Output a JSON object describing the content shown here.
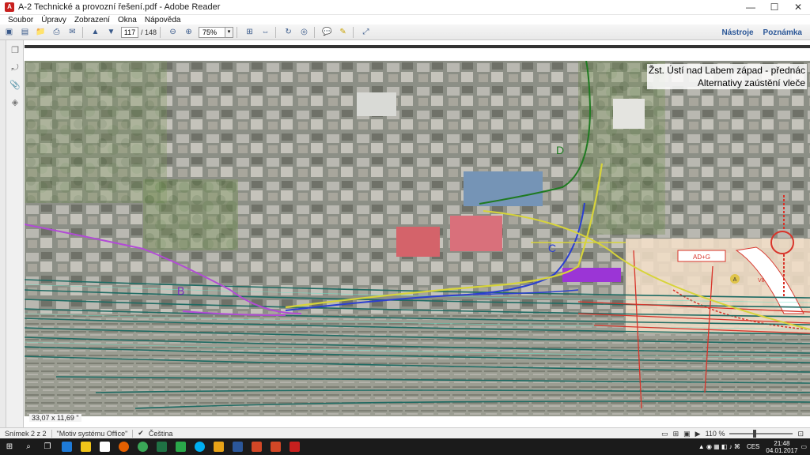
{
  "window": {
    "title": "A-2 Technické a provozní řešení.pdf - Adobe Reader",
    "minimize": "—",
    "maximize": "☐",
    "close": "✕"
  },
  "menu": [
    "Soubor",
    "Úpravy",
    "Zobrazení",
    "Okna",
    "Nápověda"
  ],
  "toolbar": {
    "page_current": "117",
    "page_total": "/ 148",
    "zoom": "75%",
    "tools_label": "Nástroje",
    "comment_label": "Poznámka"
  },
  "map": {
    "title_line1": "Žst. Ústí nad Labem západ - přednác",
    "title_line2": "Alternativy zaústění vleče",
    "labels": {
      "b": "B",
      "c": "C",
      "d": "D",
      "a": "A",
      "block_label": "AD+G",
      "v8": "V8"
    },
    "colors": {
      "green_track": "#1b7a4e",
      "teal_rails": "#1e6b63",
      "purple_route": "#b24bd6",
      "blue_route": "#2b3fd0",
      "yellow_route": "#d7d43a",
      "dark_green_route": "#1f7a21",
      "red_plan": "#d8342a"
    }
  },
  "doc": {
    "page_size": "33,07 x 11,69 \""
  },
  "status": {
    "slide": "Snímek 2 z 2",
    "theme": "\"Motiv systému Office\"",
    "language": "Čeština",
    "zoom_percent": "110 %"
  },
  "taskbar": {
    "lang": "CES",
    "time": "21:48",
    "date": "04.01.2017"
  }
}
